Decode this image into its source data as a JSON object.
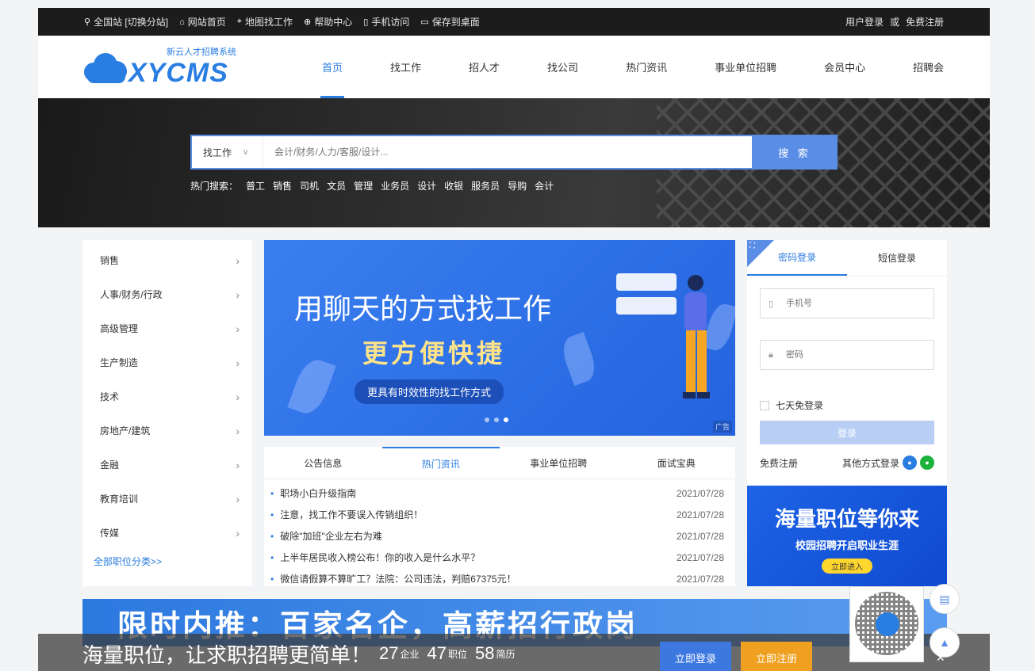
{
  "topbar": {
    "links": [
      {
        "icon": "location-icon",
        "glyph": "⚲",
        "label": "全国站 [切换分站]"
      },
      {
        "icon": "home-icon",
        "glyph": "⌂",
        "label": "网站首页"
      },
      {
        "icon": "map-icon",
        "glyph": "⌖",
        "label": "地图找工作"
      },
      {
        "icon": "help-icon",
        "glyph": "⊕",
        "label": "帮助中心"
      },
      {
        "icon": "mobile-icon",
        "glyph": "▯",
        "label": "手机访问"
      },
      {
        "icon": "desktop-icon",
        "glyph": "▭",
        "label": "保存到桌面"
      }
    ],
    "login": "用户登录",
    "or": "或",
    "register": "免费注册"
  },
  "logo": {
    "sub": "新云人才招聘系统",
    "main": "XYCMS"
  },
  "nav": [
    "首页",
    "找工作",
    "招人才",
    "找公司",
    "热门资讯",
    "事业单位招聘",
    "会员中心",
    "招聘会"
  ],
  "search": {
    "type": "找工作",
    "placeholder": "会计/财务/人力/客服/设计...",
    "button": "搜 索",
    "hot_label": "热门搜索：",
    "hot": [
      "普工",
      "销售",
      "司机",
      "文员",
      "管理",
      "业务员",
      "设计",
      "收银",
      "服务员",
      "导购",
      "会计"
    ]
  },
  "categories": [
    "销售",
    "人事/财务/行政",
    "高级管理",
    "生产制造",
    "技术",
    "房地产/建筑",
    "金融",
    "教育培训",
    "传媒"
  ],
  "all_categories": "全部职位分类>>",
  "banner": {
    "t1": "用聊天的方式找工作",
    "t2": "更方便快捷",
    "t3": "更具有时效性的找工作方式",
    "ad": "广告"
  },
  "news": {
    "tabs": [
      "公告信息",
      "热门资讯",
      "事业单位招聘",
      "面试宝典"
    ],
    "items": [
      {
        "title": "职场小白升级指南",
        "date": "2021/07/28"
      },
      {
        "title": "注意，找工作不要误入传销组织！",
        "date": "2021/07/28"
      },
      {
        "title": "破除\"加班\"企业左右为难",
        "date": "2021/07/28"
      },
      {
        "title": "上半年居民收入榜公布！你的收入是什么水平？",
        "date": "2021/07/28"
      },
      {
        "title": "微信请假算不算旷工？法院：公司违法，判赔67375元！",
        "date": "2021/07/28"
      }
    ]
  },
  "login": {
    "tab_password": "密码登录",
    "tab_sms": "短信登录",
    "phone_placeholder": "手机号",
    "password_placeholder": "密码",
    "remember": "七天免登录",
    "submit": "登录",
    "register": "免费注册",
    "other": "其他方式登录"
  },
  "ad2": {
    "a1": "海量职位等你来",
    "a2": "校园招聘开启职业生涯",
    "a3": "立即进入"
  },
  "bottom_ad": "限时内推：百家名企，高薪招行政岗",
  "floatbar": {
    "slogan": "海量职位，让求职招聘更简单！",
    "n1": "27",
    "u1": "企业",
    "n2": "47",
    "u2": "职位",
    "n3": "58",
    "u3": "简历",
    "login": "立即登录",
    "register": "立即注册"
  },
  "colors": {
    "accent": "#2a7de1",
    "button": "#5a8de6",
    "register": "#f0a020"
  }
}
